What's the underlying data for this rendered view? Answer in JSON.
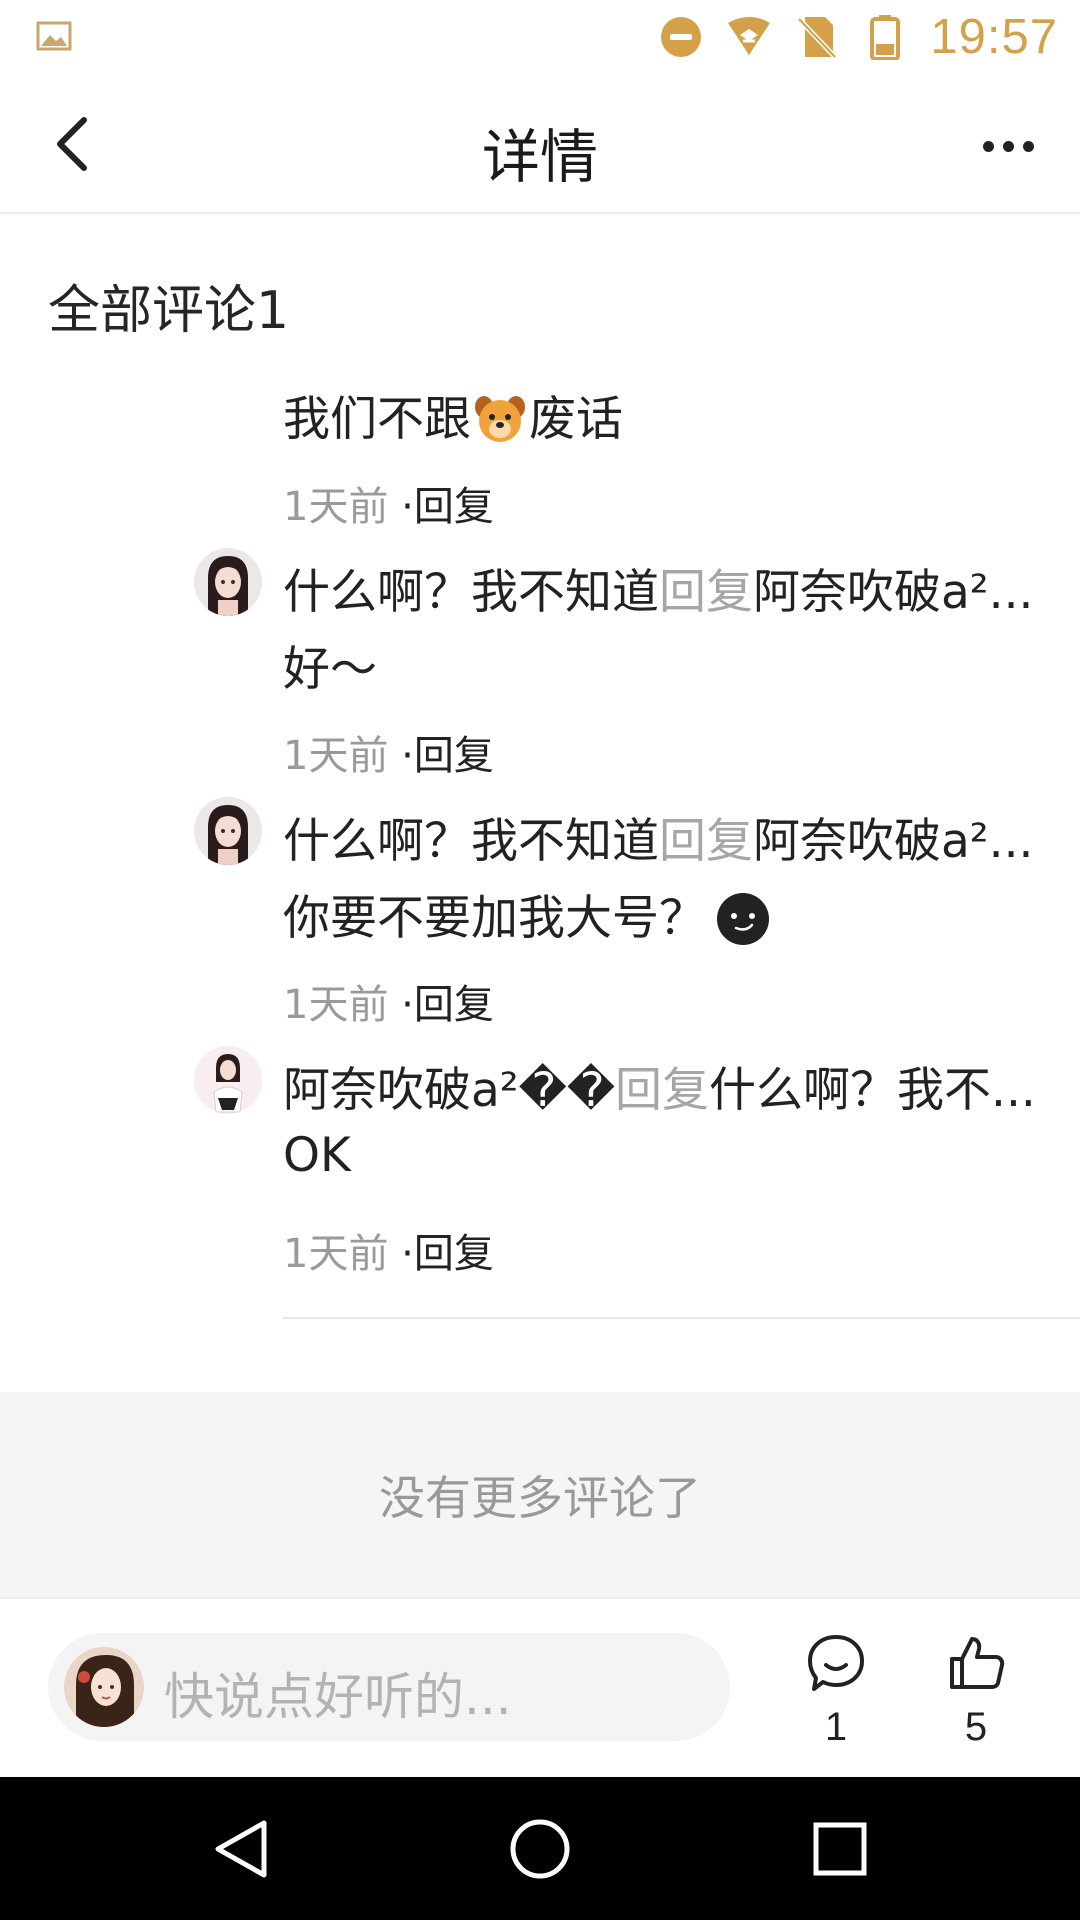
{
  "status_bar": {
    "time": "19:57",
    "accent_color": "#d4a14a",
    "icons": [
      "image-icon",
      "do-not-disturb-icon",
      "wifi-icon",
      "no-sim-icon",
      "battery-icon"
    ]
  },
  "header": {
    "title": "详情",
    "back_icon": "back-arrow-icon",
    "more_icon": "more-dots-icon"
  },
  "comments_section": {
    "title": "全部评论1",
    "items": [
      {
        "text_before": "我们不跟",
        "emoji": "dog-emoji",
        "text_after": "废话",
        "time": "1天前",
        "reply_label": "·回复"
      },
      {
        "author": "什么啊？我不知道",
        "reply_word": "回复",
        "target": "阿奈吹破a²...",
        "text": "好～",
        "time": "1天前",
        "reply_label": "·回复"
      },
      {
        "author": "什么啊？我不知道",
        "reply_word": "回复",
        "target": "阿奈吹破a²...",
        "text": "你要不要加我大号？",
        "emoji": "smirk-face-emoji",
        "time": "1天前",
        "reply_label": "·回复"
      },
      {
        "author": "阿奈吹破a²��",
        "reply_word": "回复",
        "target": "什么啊？我不...",
        "text": "OK",
        "time": "1天前",
        "reply_label": "·回复"
      }
    ]
  },
  "no_more_text": "没有更多评论了",
  "input_bar": {
    "placeholder": "快说点好听的...",
    "comment_count": "1",
    "like_count": "5"
  },
  "nav_bar": {
    "icons": [
      "nav-back-icon",
      "nav-home-icon",
      "nav-recents-icon"
    ]
  }
}
